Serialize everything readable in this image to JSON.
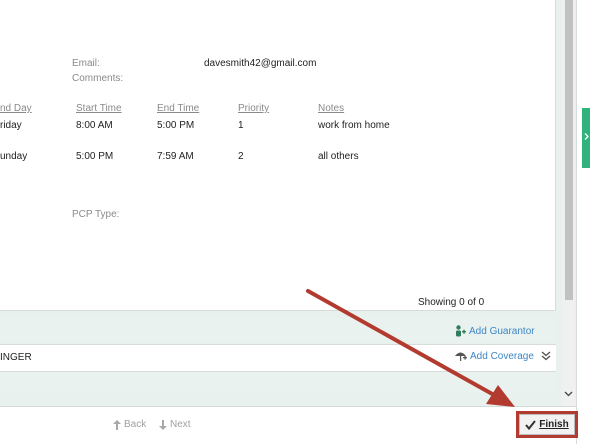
{
  "contact": {
    "email_label": "Email:",
    "email_value": "davesmith42@gmail.com",
    "comments_label": "Comments:",
    "pcp_label": "PCP Type:"
  },
  "schedule": {
    "headers": [
      "End Day",
      "Start Time",
      "End Time",
      "Priority",
      "Notes"
    ],
    "rows": [
      [
        "riday",
        "8:00 AM",
        "5:00 PM",
        "1",
        "work from home"
      ],
      [
        "unday",
        "5:00 PM",
        "7:59 AM",
        "2",
        "all others"
      ]
    ],
    "header_end_day_visible": "nd Day"
  },
  "showing": "Showing 0 of 0",
  "actions": {
    "add_guarantor": "Add Guarantor",
    "add_coverage": "Add Coverage",
    "row_text": "INGER"
  },
  "footer": {
    "back_label": "Back",
    "next_label": "Next",
    "finish_label": "Finish"
  },
  "colors": {
    "accent": "#2fb37a",
    "link": "#3d86c6",
    "annotation": "#b23a2e"
  },
  "icons": {
    "up_arrow": "up-arrow-icon",
    "down_arrow": "down-arrow-icon",
    "check": "check-icon",
    "guarantor": "person-plus-icon",
    "coverage": "umbrella-icon",
    "chevrons": "double-chevron-down-icon"
  }
}
